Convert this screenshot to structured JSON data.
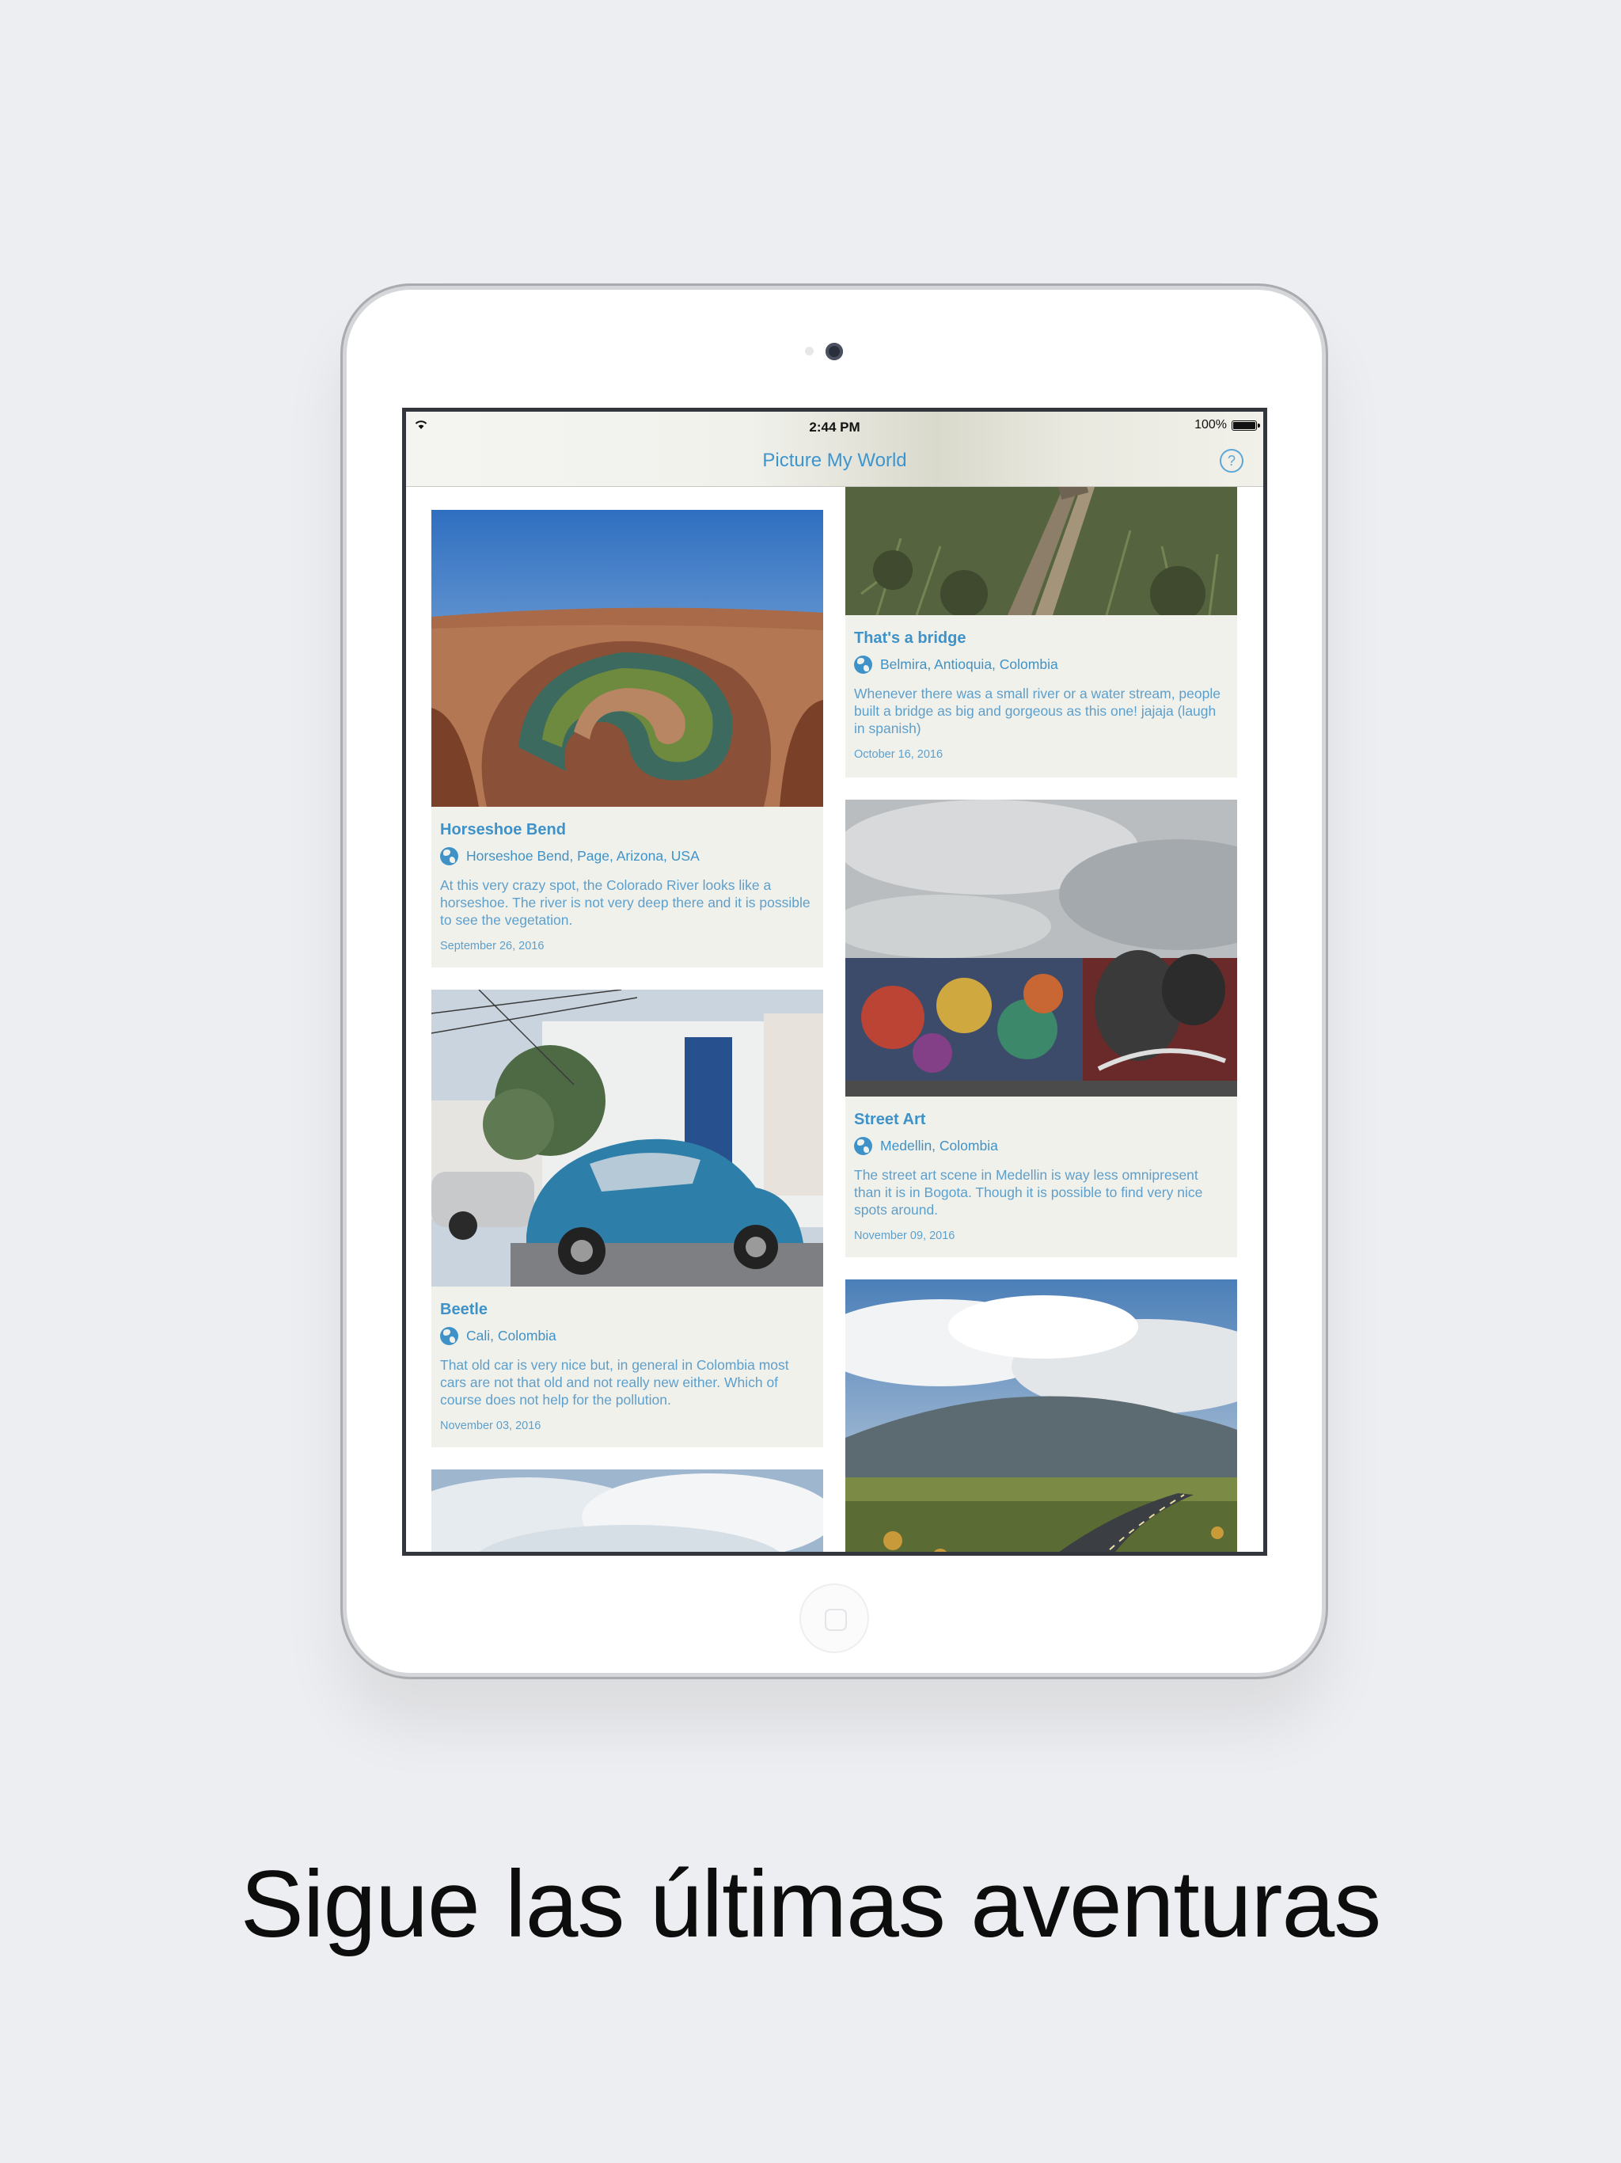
{
  "status_bar": {
    "time": "2:44 PM",
    "battery": "100%"
  },
  "navbar": {
    "title": "Picture My World",
    "help_icon": "question-circle-icon"
  },
  "posts": [
    {
      "title": "Horseshoe Bend",
      "location": "Horseshoe Bend, Page, Arizona, USA",
      "description": "At this very crazy spot, the Colorado River looks like a horseshoe. The river is not very deep there and it is possible to see the vegetation.",
      "date": "September 26, 2016"
    },
    {
      "title": "That's a bridge",
      "location": "Belmira, Antioquia, Colombia",
      "description": "Whenever there was a small river or a water stream, people built a bridge as big and gorgeous as this one! jajaja (laugh in spanish)",
      "date": "October 16, 2016"
    },
    {
      "title": "Street Art",
      "location": "Medellin, Colombia",
      "description": "The street art scene in Medellin is way less omnipresent than it is in Bogota. Though it is possible to find very nice spots around.",
      "date": "November 09, 2016"
    },
    {
      "title": "Beetle",
      "location": "Cali, Colombia",
      "description": "That old car is very nice but, in general in Colombia most cars are not that old and not really new either. Which of course does not help for the pollution.",
      "date": "November 03, 2016"
    }
  ],
  "caption": "Sigue las últimas aventuras",
  "colors": {
    "accent": "#3f92c7",
    "card_bg": "#f1f1ec",
    "page_bg": "#edeef1"
  }
}
